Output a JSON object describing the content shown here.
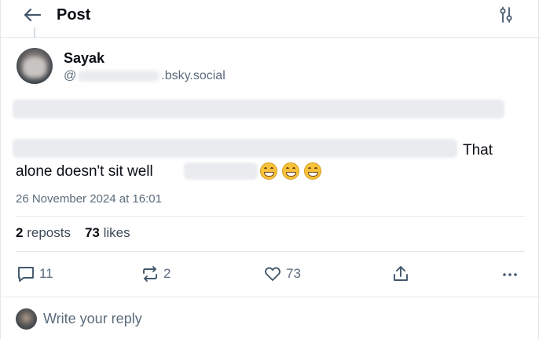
{
  "header": {
    "title": "Post",
    "back_icon": "arrow-left-icon",
    "filter_icon": "sliders-icon"
  },
  "post": {
    "author": {
      "name": "Sayak",
      "handle_prefix": "@",
      "handle_suffix": ".bsky.social"
    },
    "text": {
      "line2_tail": "That",
      "line3_head": "alone doesn't sit well"
    },
    "emoji_count": 3,
    "timestamp": "26 November 2024 at 16:01",
    "stats": {
      "reposts_count": "2",
      "reposts_label": "reposts",
      "likes_count": "73",
      "likes_label": "likes"
    },
    "actions": {
      "reply_count": "11",
      "repost_count": "2",
      "like_count": "73"
    }
  },
  "reply": {
    "placeholder": "Write your reply"
  },
  "colors": {
    "text_primary": "#0b0f14",
    "text_secondary": "#5b6b7b",
    "border": "#e3e7ec",
    "icon": "#42576c"
  }
}
